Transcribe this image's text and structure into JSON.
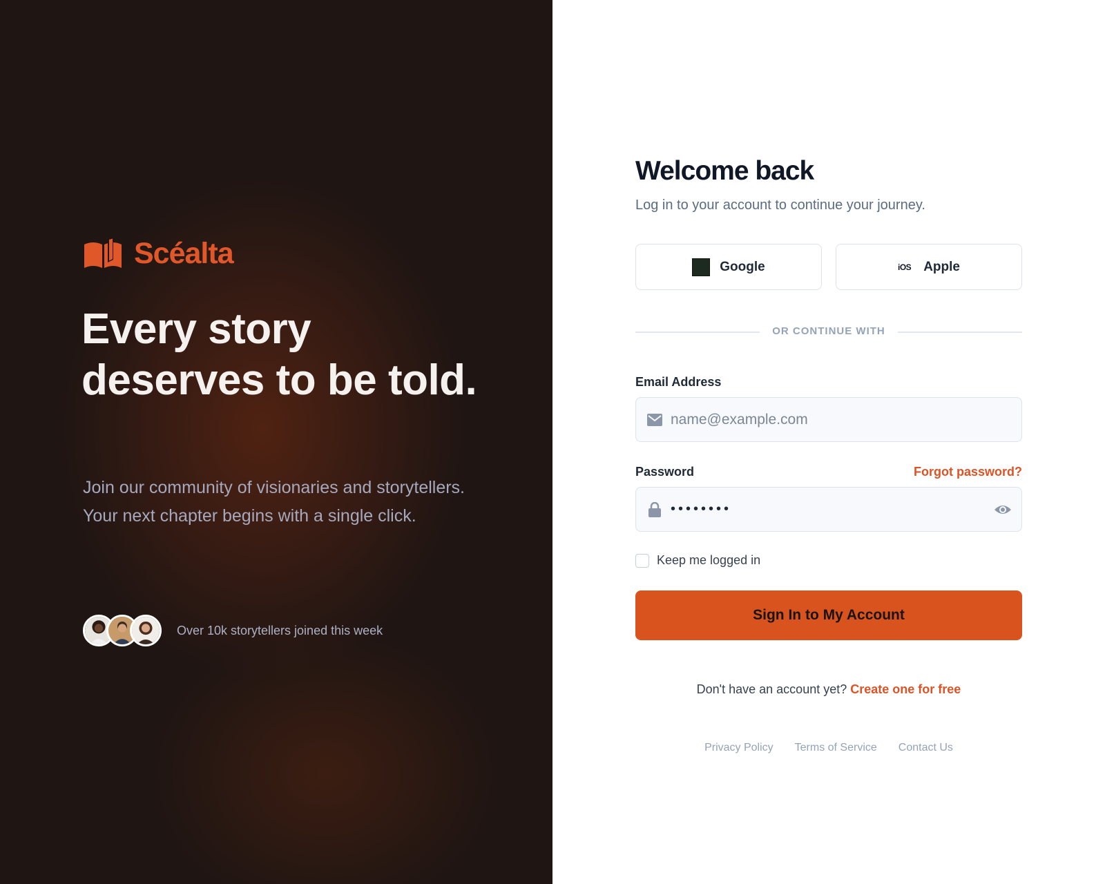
{
  "brand": {
    "name": "Scéalta",
    "accent_color": "#e0582a",
    "logo_icon": "open-book-icon"
  },
  "hero": {
    "headline": "Every story deserves to be told.",
    "subtext": "Join our community of visionaries and storytellers. Your next chapter begins with a single click.",
    "social_proof": "Over 10k storytellers joined this week",
    "avatars": [
      "avatar-woman-1",
      "avatar-man",
      "avatar-woman-2"
    ]
  },
  "login": {
    "title": "Welcome back",
    "subtitle": "Log in to your account to continue your journey.",
    "oauth": {
      "google_label": "Google",
      "apple_label": "Apple",
      "apple_icon_text": "iOS"
    },
    "divider": "OR CONTINUE WITH",
    "email": {
      "label": "Email Address",
      "placeholder": "name@example.com",
      "value": ""
    },
    "password": {
      "label": "Password",
      "forgot": "Forgot password?",
      "value": "password"
    },
    "keep_logged_in": "Keep me logged in",
    "submit": "Sign In to My Account",
    "signup_prompt": "Don't have an account yet?",
    "signup_link": "Create one for free",
    "primary_color": "#d9531e"
  },
  "footer": {
    "privacy": "Privacy Policy",
    "terms": "Terms of Service",
    "contact": "Contact Us"
  }
}
